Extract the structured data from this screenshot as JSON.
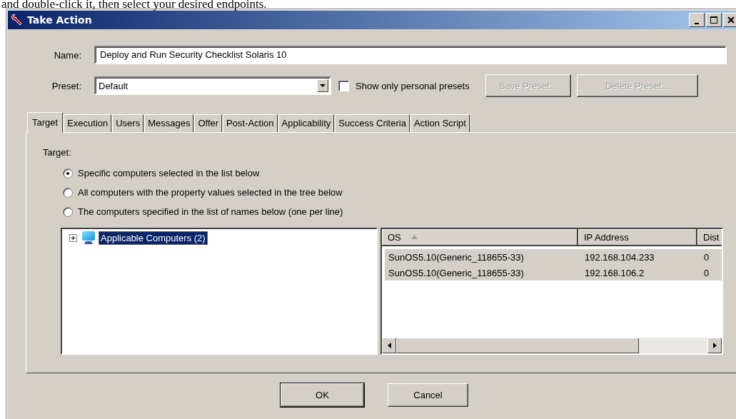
{
  "page_caption": "and double-click it, then select your desired endpoints.",
  "window": {
    "title": "Take Action"
  },
  "name_field": {
    "label": "Name:",
    "value": "Deploy and Run Security Checklist Solaris 10"
  },
  "preset": {
    "label": "Preset:",
    "value": "Default",
    "checkbox": {
      "label": "Show only personal presets",
      "checked": false
    },
    "buttons": [
      {
        "label": "Save Preset...",
        "disabled": true
      },
      {
        "label": "Delete Preset...",
        "disabled": true
      }
    ]
  },
  "tabs": [
    {
      "label": "Target",
      "selected": true
    },
    {
      "label": "Execution",
      "selected": false
    },
    {
      "label": "Users",
      "selected": false
    },
    {
      "label": "Messages",
      "selected": false
    },
    {
      "label": "Offer",
      "selected": false
    },
    {
      "label": "Post-Action",
      "selected": false
    },
    {
      "label": "Applicability",
      "selected": false
    },
    {
      "label": "Success Criteria",
      "selected": false
    },
    {
      "label": "Action Script",
      "selected": false
    }
  ],
  "target": {
    "label": "Target:",
    "options": [
      {
        "label": "Specific computers selected in the list below",
        "selected": true
      },
      {
        "label": "All computers with the property values selected in the tree below",
        "selected": false
      },
      {
        "label": "The computers specified in the list of names below (one per line)",
        "selected": false
      }
    ]
  },
  "tree": {
    "items": [
      {
        "label": "Applicable Computers (2)",
        "expanded": false,
        "selected": true
      }
    ]
  },
  "table": {
    "columns": [
      {
        "label": "OS",
        "sorted": true
      },
      {
        "label": "IP Address"
      },
      {
        "label": "Dist"
      }
    ],
    "rows": [
      {
        "cells": [
          "SunOS5.10(Generic_118655-33)",
          "192.168.104.233",
          "0"
        ],
        "selected": true
      },
      {
        "cells": [
          "SunOS5.10(Generic_118655-33)",
          "192.168.106.2",
          "0"
        ],
        "selected": true
      }
    ]
  },
  "buttons": [
    {
      "label": "OK",
      "default": true
    },
    {
      "label": "Cancel",
      "default": false
    }
  ]
}
